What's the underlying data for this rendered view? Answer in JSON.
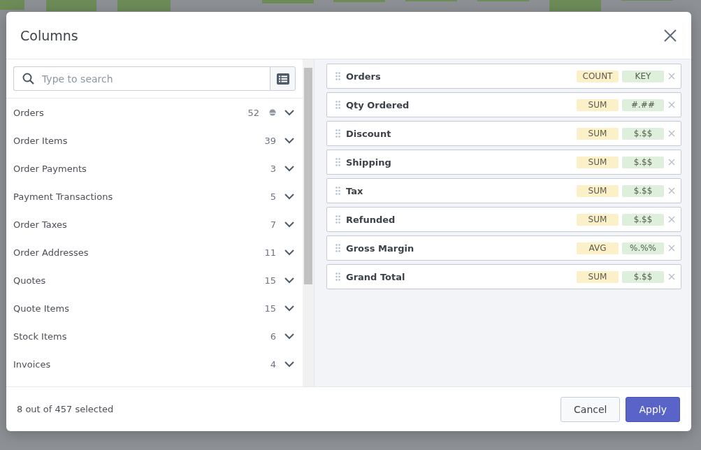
{
  "dialog": {
    "title": "Columns"
  },
  "search": {
    "placeholder": "Type to search"
  },
  "groups": [
    {
      "label": "Orders",
      "count": "52",
      "partial": true,
      "expanded": false
    },
    {
      "label": "Order Items",
      "count": "39",
      "partial": false,
      "expanded": false
    },
    {
      "label": "Order Payments",
      "count": "3",
      "partial": false,
      "expanded": false
    },
    {
      "label": "Payment Transactions",
      "count": "5",
      "partial": false,
      "expanded": false
    },
    {
      "label": "Order Taxes",
      "count": "7",
      "partial": false,
      "expanded": false
    },
    {
      "label": "Order Addresses",
      "count": "11",
      "partial": false,
      "expanded": false
    },
    {
      "label": "Quotes",
      "count": "15",
      "partial": false,
      "expanded": false
    },
    {
      "label": "Quote Items",
      "count": "15",
      "partial": false,
      "expanded": false
    },
    {
      "label": "Stock Items",
      "count": "6",
      "partial": false,
      "expanded": false
    },
    {
      "label": "Invoices",
      "count": "4",
      "partial": false,
      "expanded": false
    }
  ],
  "selected_columns": [
    {
      "name": "Orders",
      "aggregate": "COUNT",
      "format": "KEY"
    },
    {
      "name": "Qty Ordered",
      "aggregate": "SUM",
      "format": "#.##"
    },
    {
      "name": "Discount",
      "aggregate": "SUM",
      "format": "$.$$"
    },
    {
      "name": "Shipping",
      "aggregate": "SUM",
      "format": "$.$$"
    },
    {
      "name": "Tax",
      "aggregate": "SUM",
      "format": "$.$$"
    },
    {
      "name": "Refunded",
      "aggregate": "SUM",
      "format": "$.$$"
    },
    {
      "name": "Gross Margin",
      "aggregate": "AVG",
      "format": "%.%%"
    },
    {
      "name": "Grand Total",
      "aggregate": "SUM",
      "format": "$.$$"
    }
  ],
  "footer": {
    "status": "8 out of 457 selected",
    "buttons": [
      {
        "label": "Cancel",
        "kind": "secondary"
      },
      {
        "label": "Apply",
        "kind": "primary"
      }
    ]
  }
}
